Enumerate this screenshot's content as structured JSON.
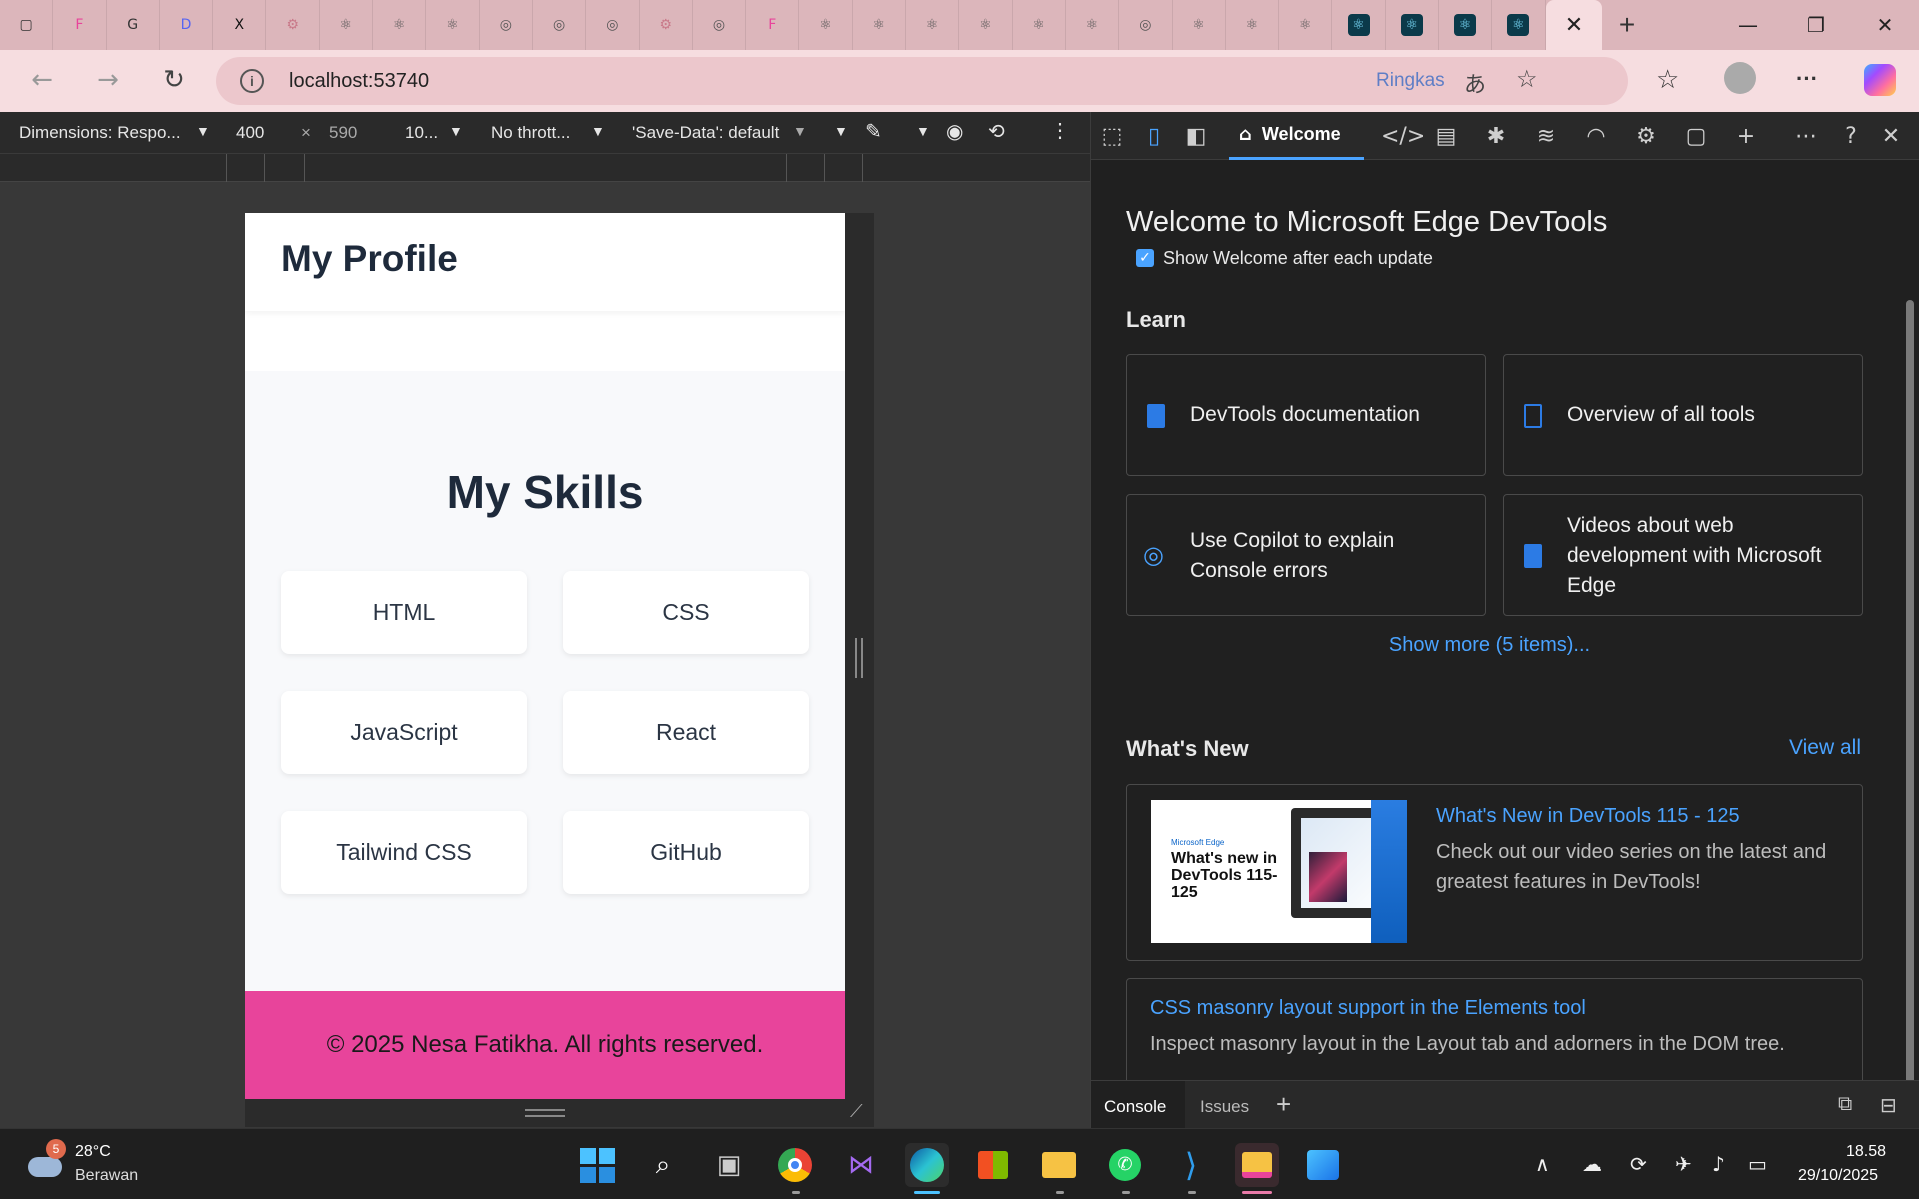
{
  "browser": {
    "tab_glyphs": [
      "▢",
      "F",
      "G",
      "D",
      "X",
      "⚙",
      "⚛",
      "⚛",
      "⚛",
      "◎",
      "◎",
      "◎",
      "⚙",
      "◎",
      "F",
      "⚛",
      "⚛",
      "⚛",
      "⚛",
      "⚛",
      "⚛",
      "◎",
      "⚛",
      "⚛",
      "⚛",
      "⚛",
      "⚛",
      "⚛",
      "⚛"
    ],
    "active_tab_close": "✕",
    "new_tab": "+",
    "win_min": "—",
    "win_max": "❐",
    "win_close": "✕",
    "back": "←",
    "forward": "→",
    "reload": "↻",
    "info": "i",
    "url": "localhost:53740",
    "ringkas": "Ringkas",
    "more": "···"
  },
  "device_toolbar": {
    "dimensions": "Dimensions: Respo...",
    "width": "400",
    "times": "×",
    "height": "590",
    "zoom": "10...",
    "throttle": "No thrott...",
    "save_data": "'Save-Data': default"
  },
  "page": {
    "title": "My Profile",
    "skills_heading": "My Skills",
    "skills": [
      "HTML",
      "CSS",
      "JavaScript",
      "React",
      "Tailwind CSS",
      "GitHub"
    ],
    "footer": "© 2025 Nesa Fatikha. All rights reserved."
  },
  "devtools": {
    "welcome_tab": "Welcome",
    "heading": "Welcome to Microsoft Edge DevTools",
    "show_welcome": "Show Welcome after each update",
    "learn": "Learn",
    "learn_cards": [
      "DevTools documentation",
      "Overview of all tools",
      "Use Copilot to explain Console errors",
      "Videos about web development with Microsoft Edge"
    ],
    "show_more": "Show more (5 items)...",
    "whats_new": "What's New",
    "view_all": "View all",
    "news": [
      {
        "title": "What's New in DevTools 115 - 125",
        "desc": "Check out our video series on the latest and greatest features in DevTools!"
      },
      {
        "title": "CSS masonry layout support in the Elements tool",
        "desc": "Inspect masonry layout in the Layout tab and adorners in the DOM tree."
      }
    ],
    "thumb_brand": "Microsoft Edge",
    "thumb_title": "What's new in DevTools 115-125",
    "drawer_console": "Console",
    "drawer_issues": "Issues",
    "drawer_add": "+"
  },
  "taskbar": {
    "weather_temp": "28°C",
    "weather_desc": "Berawan",
    "weather_badge": "5",
    "time": "18.58",
    "date": "29/10/2025"
  }
}
